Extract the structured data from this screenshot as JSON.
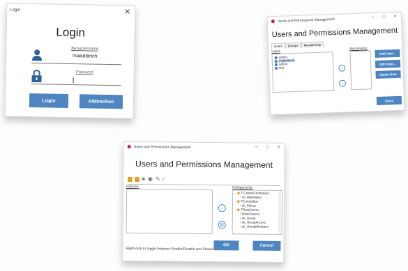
{
  "login": {
    "window_title": "Login",
    "close_glyph": "✕",
    "heading": "Login",
    "username_label": "Benutzername",
    "username_value": "maikdittrich",
    "password_label": "Passwort",
    "login_button": "Login",
    "cancel_button": "Abbrechen",
    "accent": "#4f86c1"
  },
  "users_window": {
    "window_title": "Users and Permissions Management",
    "heading": "Users and Permissions Management",
    "tabs": [
      "Users",
      "Groups",
      "Membership"
    ],
    "users_label": "Users:",
    "permissions_label": "Permissions:",
    "users": [
      "admin",
      "maikdittrich",
      "admin",
      "test"
    ],
    "selected_user_index": 1,
    "buttons": {
      "add": "Add User...",
      "edit": "Edit User...",
      "delete": "Delete User",
      "close": "Close"
    }
  },
  "policies_window": {
    "window_title": "Users and Permissions Management",
    "heading": "Users and Permissions Management",
    "policies_label": "Policies:",
    "components_label": "Components:",
    "toolbar_icons": [
      "folder-icon",
      "folder-add-icon",
      "lock-icon",
      "eye-icon",
      "pen-icon",
      "brush-icon"
    ],
    "components": [
      {
        "text": "TColumnComboBox",
        "level": 0
      },
      {
        "text": "cb_Mitarbeiter",
        "level": 1
      },
      {
        "text": "TComboBox",
        "level": 0
      },
      {
        "text": "cb_Monat",
        "level": 1
      },
      {
        "text": "TDataSource",
        "level": 0
      },
      {
        "text": "DataSource1",
        "level": 1
      },
      {
        "text": "ds_Group",
        "level": 1
      },
      {
        "text": "ds_GroupAccess",
        "level": 1
      },
      {
        "text": "ds_GroupMembers",
        "level": 1
      }
    ],
    "hint": "Right-click to toggle between Enable/Disable and Show/Hi",
    "ok_button": "OK",
    "cancel_button": "Cancel"
  }
}
